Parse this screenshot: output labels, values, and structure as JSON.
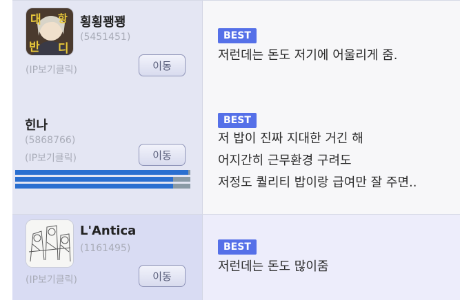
{
  "colors": {
    "best_badge": "#5570e8",
    "bar_fill": "#2a6fd0",
    "bar_track": "#8a9aa5"
  },
  "comments": [
    {
      "nickname": "횡횡꽹꽹",
      "user_id": "(5451451)",
      "ip_link": "(IP보기클릭)",
      "move_button": "이동",
      "badge": "BEST",
      "lines": [
        "저런데는 돈도 저기에 어울리게 줌."
      ],
      "avatar_text": [
        "대",
        "항",
        "반",
        "디"
      ]
    },
    {
      "nickname": "힌나",
      "user_id": "(5868766)",
      "ip_link": "(IP보기클릭)",
      "move_button": "이동",
      "badge": "BEST",
      "lines": [
        "저 밥이 진짜 지대한 거긴 해",
        "어지간히 근무환경 구려도",
        "저정도 퀄리티 밥이랑 급여만 잘 주면.."
      ],
      "bars": [
        0.99,
        0.9,
        0.9
      ]
    },
    {
      "nickname": "L'Antica",
      "user_id": "(1161495)",
      "ip_link": "(IP보기클릭)",
      "move_button": "이동",
      "badge": "BEST",
      "lines": [
        "저런데는 돈도 많이줌"
      ]
    }
  ]
}
